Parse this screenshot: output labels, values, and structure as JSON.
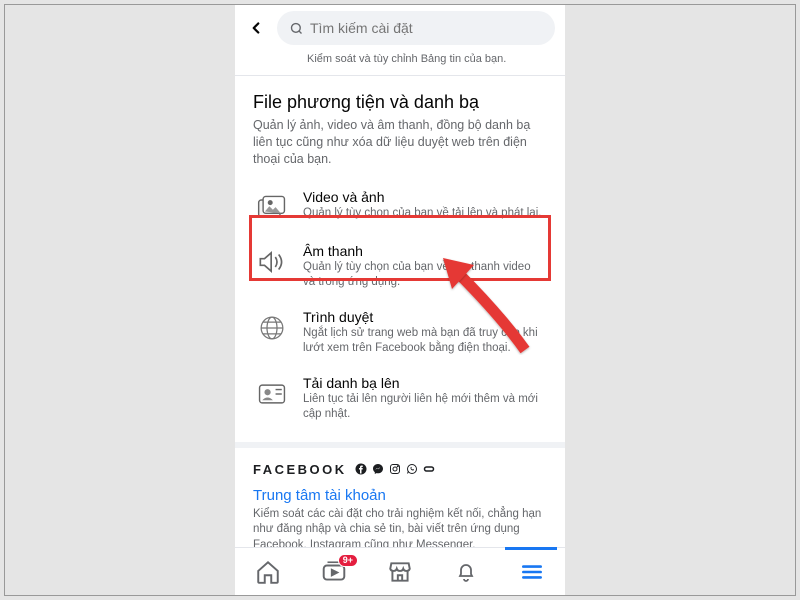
{
  "search": {
    "placeholder": "Tìm kiếm cài đặt"
  },
  "prev_item_desc_tail": "Kiểm soát và tùy chỉnh Bảng tin của bạn.",
  "section": {
    "title": "File phương tiện và danh bạ",
    "desc": "Quản lý ảnh, video và âm thanh, đồng bộ danh bạ liên tục cũng như xóa dữ liệu duyệt web trên điện thoại của bạn."
  },
  "items": {
    "video": {
      "title": "Video và ảnh",
      "desc": "Quản lý tùy chọn của bạn về tải lên và phát lại."
    },
    "sound": {
      "title": "Âm thanh",
      "desc": "Quản lý tùy chọn của bạn về âm thanh video và trong ứng dụng."
    },
    "browser": {
      "title": "Trình duyệt",
      "desc": "Ngắt lịch sử trang web mà bạn đã truy cập khi lướt xem trên Facebook bằng điện thoại."
    },
    "contacts": {
      "title": "Tải danh bạ lên",
      "desc": "Liên tục tải lên người liên hệ mới thêm và mới cập nhật."
    }
  },
  "brand_word": "FACEBOOK",
  "account_center": {
    "title": "Trung tâm tài khoản",
    "desc": "Kiểm soát các cài đặt cho trải nghiệm kết nối, chẳng hạn như đăng nhập và chia sẻ tin, bài viết trên ứng dụng Facebook, Instagram cũng như Messenger."
  },
  "nav": {
    "watch_badge": "9+"
  }
}
